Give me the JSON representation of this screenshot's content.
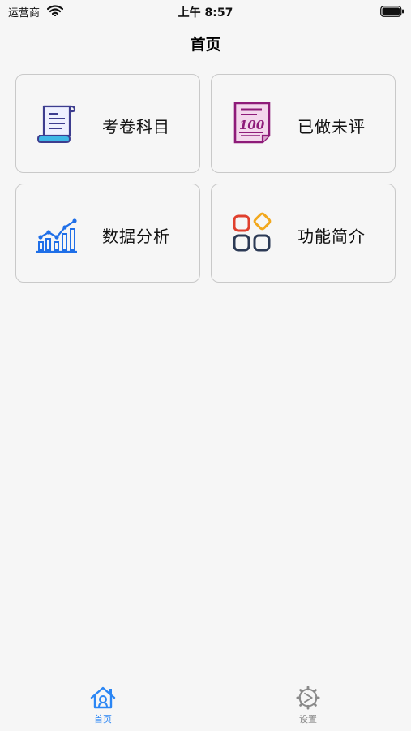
{
  "status_bar": {
    "carrier": "运营商",
    "time": "上午 8:57"
  },
  "nav": {
    "title": "首页"
  },
  "cards": [
    {
      "label": "考卷科目",
      "icon": "scroll-document-icon"
    },
    {
      "label": "已做未评",
      "icon": "score-100-paper-icon"
    },
    {
      "label": "数据分析",
      "icon": "bar-chart-trend-icon"
    },
    {
      "label": "功能简介",
      "icon": "app-grid-icon"
    }
  ],
  "tab_bar": {
    "items": [
      {
        "label": "首页",
        "icon": "home-icon",
        "active": true
      },
      {
        "label": "设置",
        "icon": "settings-gear-icon",
        "active": false
      }
    ]
  },
  "colors": {
    "accent": "#2b86f4",
    "inactive": "#8a8a8a",
    "background": "#f6f6f6"
  }
}
